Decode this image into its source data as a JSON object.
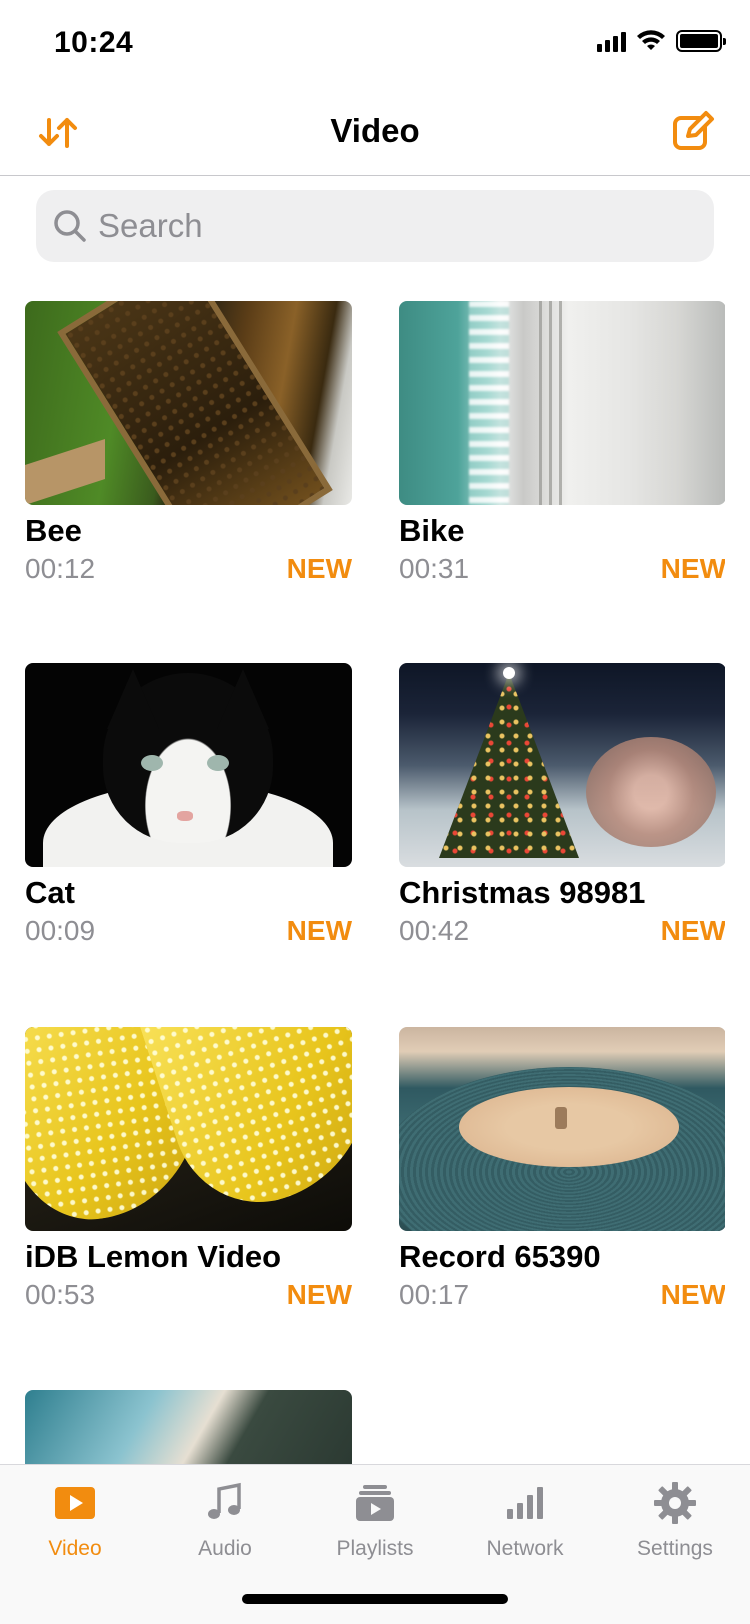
{
  "status_bar": {
    "time": "10:24"
  },
  "nav": {
    "title": "Video"
  },
  "search": {
    "placeholder": "Search"
  },
  "videos": [
    {
      "title": "Bee",
      "duration": "00:12",
      "badge": "NEW"
    },
    {
      "title": "Bike",
      "duration": "00:31",
      "badge": "NEW"
    },
    {
      "title": "Cat",
      "duration": "00:09",
      "badge": "NEW"
    },
    {
      "title": "Christmas 98981",
      "duration": "00:42",
      "badge": "NEW"
    },
    {
      "title": "iDB Lemon Video",
      "duration": "00:53",
      "badge": "NEW"
    },
    {
      "title": "Record 65390",
      "duration": "00:17",
      "badge": "NEW"
    }
  ],
  "tabs": [
    {
      "label": "Video",
      "icon": "play-icon",
      "active": true
    },
    {
      "label": "Audio",
      "icon": "music-note-icon",
      "active": false
    },
    {
      "label": "Playlists",
      "icon": "playlist-icon",
      "active": false
    },
    {
      "label": "Network",
      "icon": "network-bars-icon",
      "active": false
    },
    {
      "label": "Settings",
      "icon": "gear-icon",
      "active": false
    }
  ],
  "colors": {
    "accent": "#f28c0f",
    "secondary_text": "#8e8e93",
    "search_bg": "#efeff0"
  }
}
